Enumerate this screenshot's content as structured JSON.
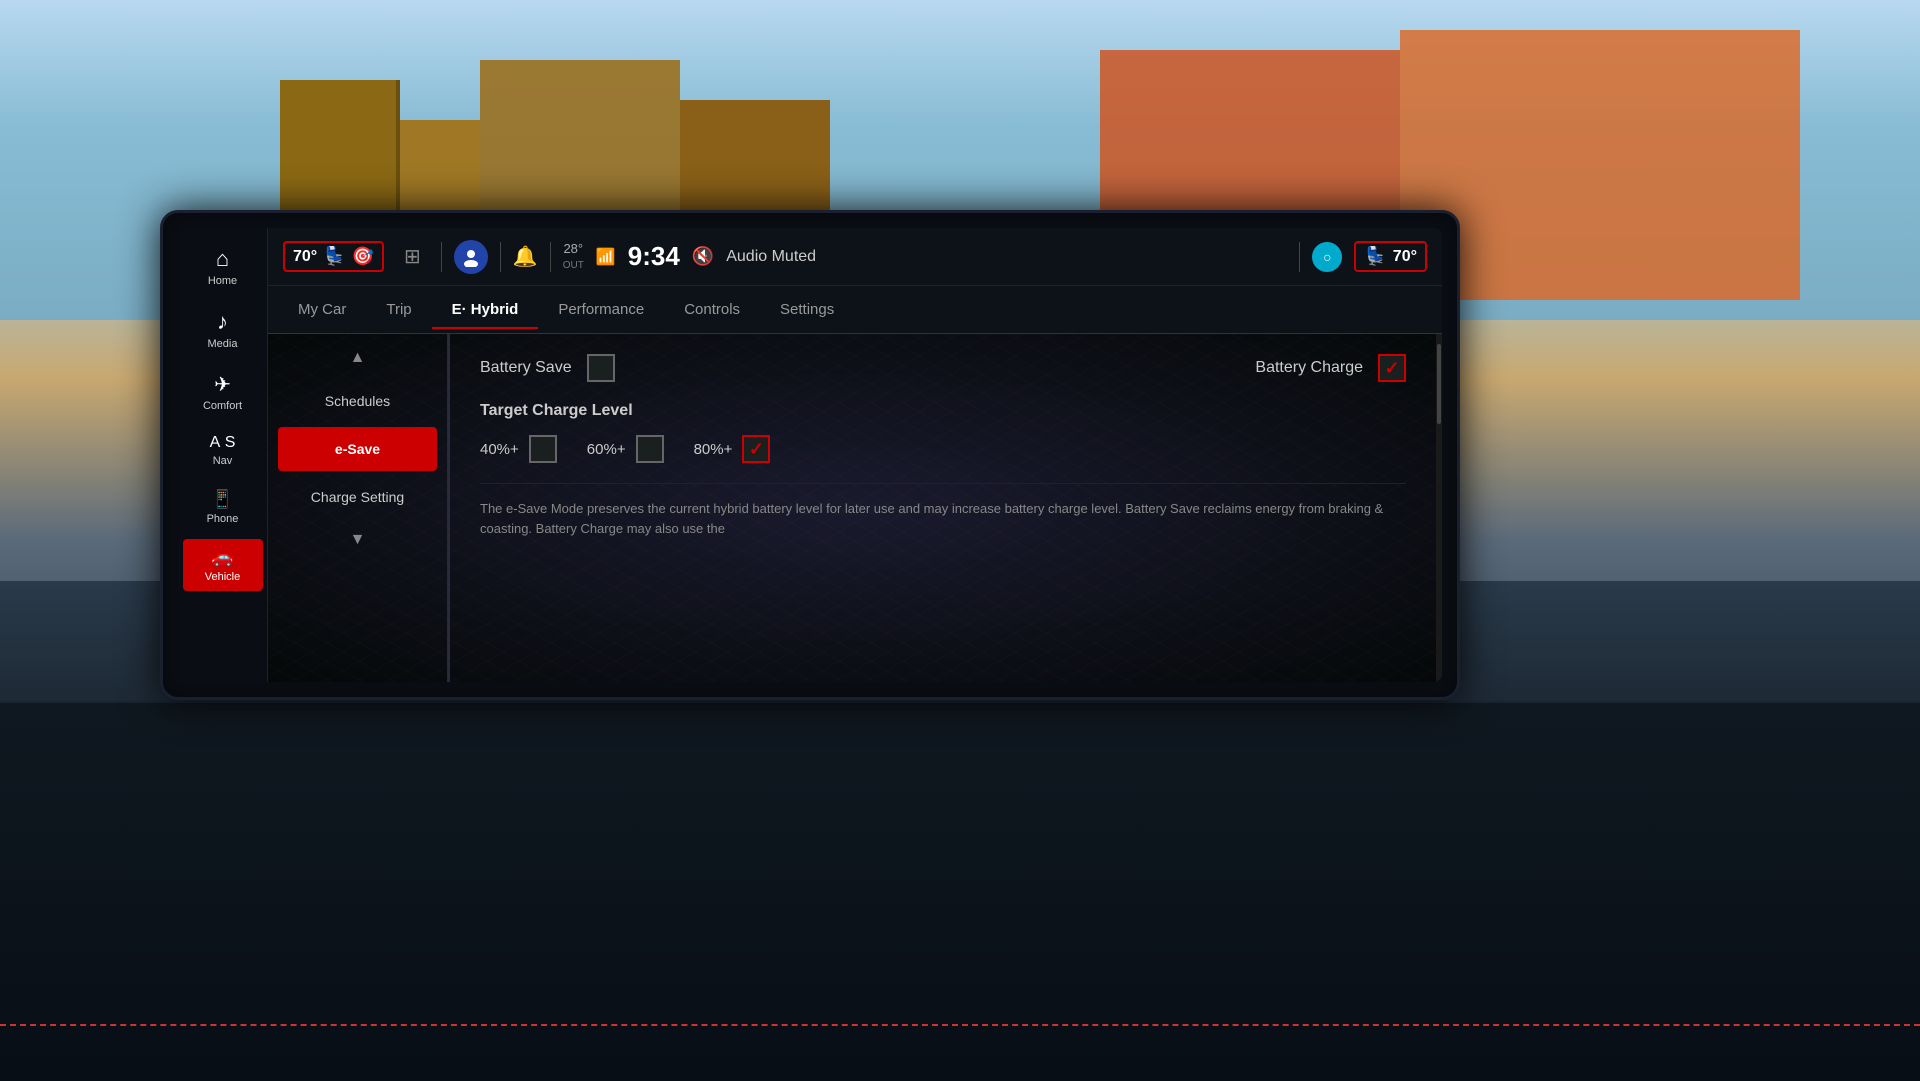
{
  "background": {
    "skyColor": "#87CEEB",
    "dashColor": "#0a1018"
  },
  "statusBar": {
    "tempLeft": "70°",
    "tempRight": "70°",
    "outsideTemp": "28°",
    "outsideTempLabel": "OUT",
    "time": "9:34",
    "audioMuted": "Audio Muted",
    "gridButtonLabel": "⊞"
  },
  "sidebar": {
    "items": [
      {
        "id": "home",
        "label": "Home",
        "icon": "⌂",
        "active": false
      },
      {
        "id": "media",
        "label": "Media",
        "icon": "♪",
        "active": false
      },
      {
        "id": "comfort",
        "label": "Comfort",
        "icon": "♟",
        "active": false
      },
      {
        "id": "nav",
        "label": "Nav",
        "icon": "A",
        "active": false
      },
      {
        "id": "phone",
        "label": "Phone",
        "icon": "□",
        "active": false
      },
      {
        "id": "vehicle",
        "label": "Vehicle",
        "icon": "🚗",
        "active": true
      }
    ]
  },
  "navTabs": {
    "tabs": [
      {
        "id": "mycar",
        "label": "My Car",
        "active": false
      },
      {
        "id": "trip",
        "label": "Trip",
        "active": false
      },
      {
        "id": "ehybrid",
        "label": "E· Hybrid",
        "active": true
      },
      {
        "id": "performance",
        "label": "Performance",
        "active": false
      },
      {
        "id": "controls",
        "label": "Controls",
        "active": false
      },
      {
        "id": "settings",
        "label": "Settings",
        "active": false
      }
    ]
  },
  "contentSidebar": {
    "items": [
      {
        "id": "schedules",
        "label": "Schedules",
        "active": false
      },
      {
        "id": "esave",
        "label": "e-Save",
        "active": true
      },
      {
        "id": "chargesetting",
        "label": "Charge Setting",
        "active": false
      }
    ]
  },
  "mainPanel": {
    "batterySave": {
      "label": "Battery Save",
      "checked": false
    },
    "batteryCharge": {
      "label": "Battery Charge",
      "checked": true
    },
    "targetChargeLevel": {
      "title": "Target Charge Level",
      "options": [
        {
          "id": "40",
          "label": "40%+",
          "checked": false
        },
        {
          "id": "60",
          "label": "60%+",
          "checked": false
        },
        {
          "id": "80",
          "label": "80%+",
          "checked": true
        }
      ]
    },
    "description": "The e-Save Mode preserves the current hybrid battery level for later use and may increase battery charge level. Battery Save reclaims energy from braking & coasting. Battery Charge may also use the"
  }
}
